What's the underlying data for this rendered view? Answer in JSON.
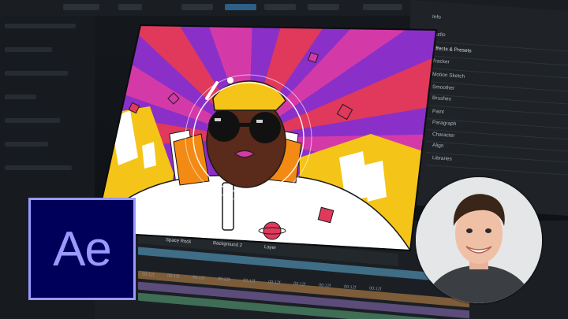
{
  "app": {
    "name": "After Effects",
    "logo_text": "Ae",
    "brand_colors": {
      "logo_bg": "#00005b",
      "logo_fg": "#9999ff"
    }
  },
  "right_panel": {
    "items": [
      "Info",
      "Audio",
      "Effects & Presets",
      "Tracker",
      "Motion Sketch",
      "Smoother",
      "Brushes",
      "Paint",
      "Paragraph",
      "Character",
      "Align",
      "Libraries"
    ]
  },
  "composition": {
    "tabs": [
      "Space Rock",
      "Background 2",
      "Layer"
    ],
    "timecode_ticks": [
      "00:12f",
      "00:12f",
      "00:12f",
      "00:12f",
      "00:12f",
      "00:12f",
      "00:12f",
      "00:12f",
      "00:12f",
      "00:12f"
    ]
  },
  "icons": {
    "logo": "after-effects-logo",
    "avatar": "presenter-avatar"
  },
  "artwork_colors": {
    "purple": "#8b2fc9",
    "magenta": "#d43aa7",
    "red": "#e0395c",
    "yellow": "#f5c418",
    "orange": "#f28a14"
  }
}
